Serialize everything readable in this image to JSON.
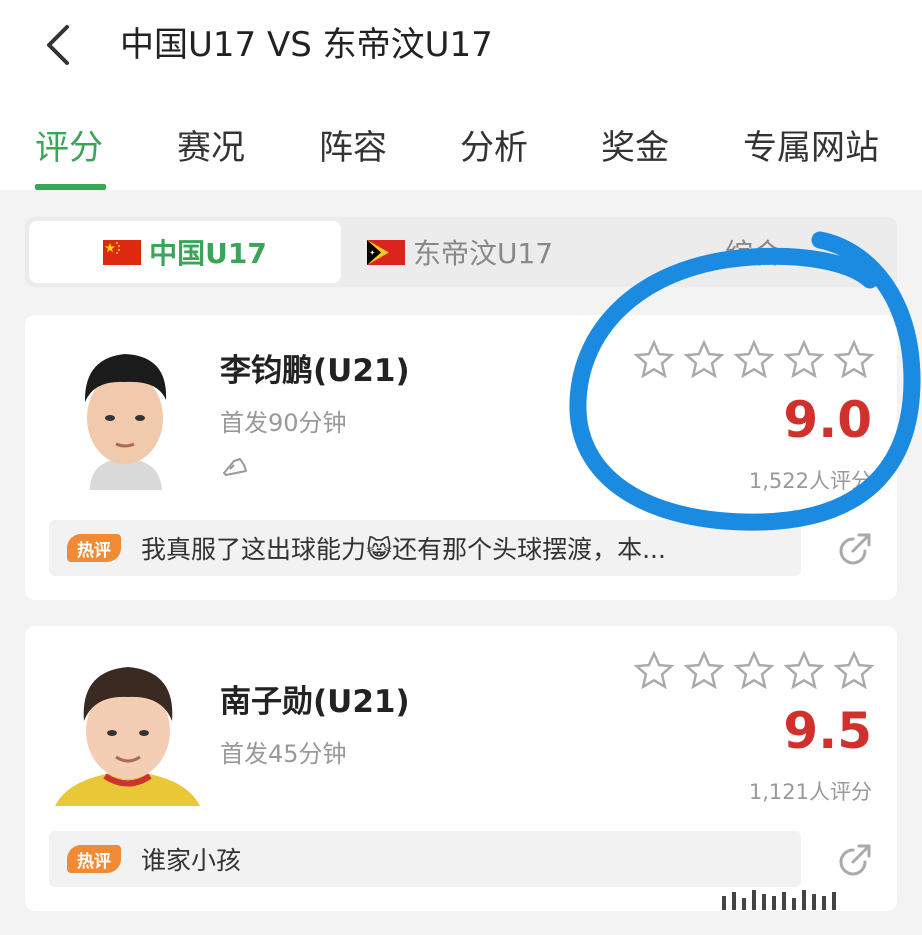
{
  "header": {
    "title": "中国U17 VS 东帝汶U17"
  },
  "tabs": [
    {
      "label": "评分",
      "active": true
    },
    {
      "label": "赛况"
    },
    {
      "label": "阵容"
    },
    {
      "label": "分析"
    },
    {
      "label": "奖金"
    },
    {
      "label": "专属网站"
    }
  ],
  "subtabs": [
    {
      "label": "中国U17",
      "flag": "china-flag",
      "active": true
    },
    {
      "label": "东帝汶U17",
      "flag": "timor-leste-flag"
    },
    {
      "label": "综合"
    }
  ],
  "players": [
    {
      "name": "李钧鹏(U21)",
      "meta": "首发90分钟",
      "stars": 5,
      "score": "9.0",
      "raters": "1,522人评分",
      "hot_label": "热评",
      "comment": "我真服了这出球能力😸还有那个头球摆渡，本..."
    },
    {
      "name": "南子勋(U21)",
      "meta": "首发45分钟",
      "stars": 5,
      "score": "9.5",
      "raters": "1,121人评分",
      "hot_label": "热评",
      "comment": "谁家小孩"
    }
  ],
  "colors": {
    "accent": "#3aa557",
    "score": "#d0312d",
    "hot": "#f08a34",
    "annotation": "#1a8be0"
  }
}
